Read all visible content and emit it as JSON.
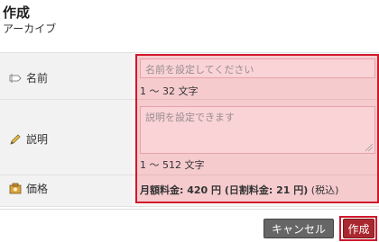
{
  "page": {
    "title": "作成",
    "subtitle": "アーカイブ"
  },
  "form": {
    "name": {
      "label": "名前",
      "icon": "tag-icon",
      "placeholder": "名前を設定してください",
      "hint": "1 ～ 32 文字"
    },
    "description": {
      "label": "説明",
      "icon": "pencil-icon",
      "placeholder": "説明を設定できます",
      "hint": "1 ～ 512 文字"
    },
    "price": {
      "label": "価格",
      "icon": "price-tag-icon",
      "monthly": "月額料金: 420 円 (日割料金: 21 円)",
      "tax": "(税込)"
    }
  },
  "buttons": {
    "cancel": "キャンセル",
    "create": "作成"
  },
  "colors": {
    "highlight_border": "#d0182b",
    "create_button": "#a9282e",
    "cancel_button": "#666666"
  }
}
